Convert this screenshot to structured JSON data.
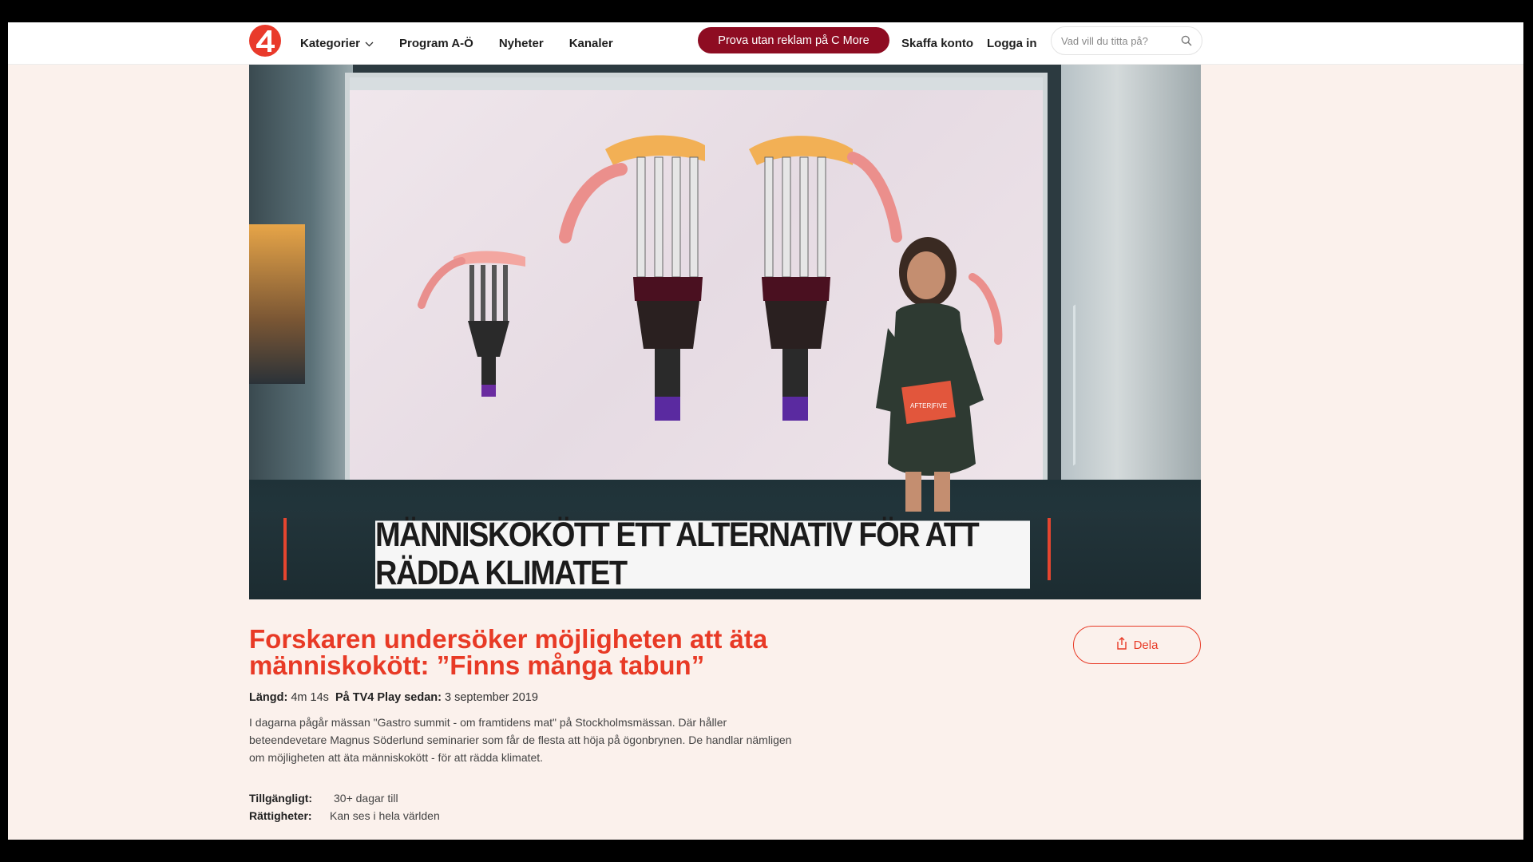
{
  "header": {
    "logo_text": "4",
    "nav": [
      {
        "label": "Kategorier",
        "has_dropdown": true
      },
      {
        "label": "Program A-Ö",
        "has_dropdown": false
      },
      {
        "label": "Nyheter",
        "has_dropdown": false
      },
      {
        "label": "Kanaler",
        "has_dropdown": false
      }
    ],
    "promo_label": "Prova utan reklam på C More",
    "create_account": "Skaffa konto",
    "login": "Logga in",
    "search_placeholder": "Vad vill du titta på?"
  },
  "video": {
    "caption": "MÄNNISKOKÖTT ETT ALTERNATIV FÖR ATT RÄDDA KLIMATET",
    "prop_text": "AFTER|FIVE"
  },
  "article": {
    "title_line1": "Forskaren undersöker möjligheten att äta",
    "title_line2": "människokött: ”Finns många tabun”",
    "share_label": "Dela",
    "length_label": "Längd:",
    "length_value": "4m 14s",
    "since_label": "På TV4 Play sedan:",
    "since_value": "3 september 2019",
    "description_line1": "I dagarna pågår mässan \"Gastro summit - om framtidens mat\" på Stockholmsmässan. Där håller",
    "description_line2": "beteendevetare Magnus Söderlund seminarier som får de flesta att höja på ögonbrynen. De handlar nämligen",
    "description_line3": "om möjligheten att äta människokött - för att rädda klimatet.",
    "available_label": "Tillgängligt:",
    "available_value": "30+ dagar till",
    "rights_label": "Rättigheter:",
    "rights_value": "Kan ses i hela världen"
  },
  "colors": {
    "brand": "#e83a26",
    "promo": "#8e0c22",
    "page_bg": "#fbf1ec"
  }
}
